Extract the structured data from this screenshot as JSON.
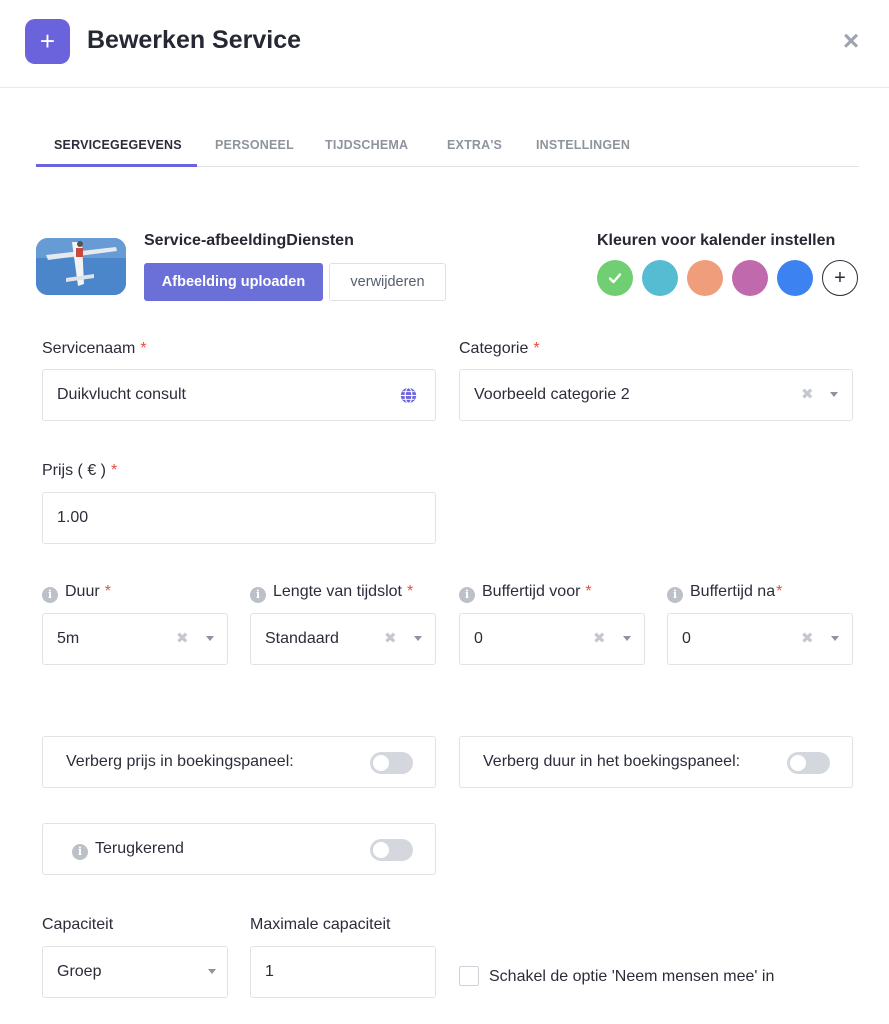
{
  "header": {
    "icon": "plus-icon",
    "title": "Bewerken Service",
    "close": "close-icon"
  },
  "tabs": [
    {
      "label": "SERVICEGEGEVENS",
      "active": true
    },
    {
      "label": "PERSONEEL",
      "active": false
    },
    {
      "label": "TIJDSCHEMA",
      "active": false
    },
    {
      "label": "EXTRA'S",
      "active": false
    },
    {
      "label": "INSTELLINGEN",
      "active": false
    }
  ],
  "image_section": {
    "title": "Service-afbeeldingDiensten",
    "upload_label": "Afbeelding uploaden",
    "remove_label": "verwijderen"
  },
  "calendar_colors": {
    "title": "Kleuren voor kalender instellen",
    "swatches": [
      "#6fcf72",
      "#55bcd2",
      "#ef9d7b",
      "#c06aad",
      "#3c82f1"
    ],
    "selected": "#6fcf72",
    "add_icon": "plus-icon"
  },
  "form": {
    "required_marker": "*",
    "service_name": {
      "label": "Servicenaam",
      "value": "Duikvlucht consult",
      "icon": "globe-icon"
    },
    "category": {
      "label": "Categorie",
      "value": "Voorbeeld categorie 2"
    },
    "price": {
      "label": "Prijs ( € )",
      "value": "1.00"
    },
    "duration": {
      "label": "Duur",
      "value": "5m"
    },
    "slot_length": {
      "label": "Lengte van tijdslot",
      "value": "Standaard"
    },
    "buffer_before": {
      "label": "Buffertijd voor",
      "value": "0"
    },
    "buffer_after": {
      "label": "Buffertijd na",
      "value": "0"
    },
    "hide_price": {
      "label": "Verberg prijs in boekingspaneel:",
      "enabled": false
    },
    "hide_duration": {
      "label": "Verberg duur in het boekingspaneel:",
      "enabled": false
    },
    "recurring": {
      "label": "Terugkerend",
      "enabled": false
    },
    "capacity": {
      "label": "Capaciteit",
      "value": "Groep"
    },
    "max_capacity": {
      "label": "Maximale capaciteit",
      "value": "1"
    },
    "bring_people": {
      "label": "Schakel de optie 'Neem mensen mee' in",
      "checked": false
    }
  },
  "info_glyph": "i",
  "clear_glyph": "✖"
}
